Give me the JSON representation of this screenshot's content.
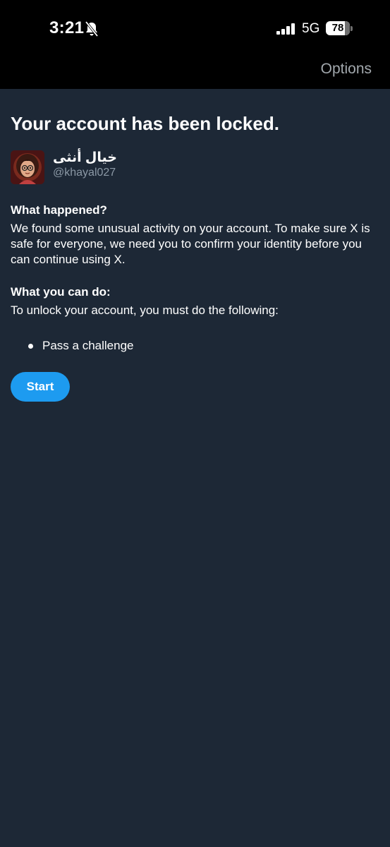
{
  "status_bar": {
    "time": "3:21",
    "network": "5G",
    "battery_percent": "78",
    "battery_level": 0.78,
    "icons": [
      "bell-slash-icon",
      "signal-icon"
    ]
  },
  "nav": {
    "options_label": "Options"
  },
  "main": {
    "title": "Your account has been locked.",
    "profile": {
      "display_name": "خيال أنثى",
      "handle": "@khayal027"
    },
    "what_happened": {
      "heading": "What happened?",
      "text": "We found some unusual activity on your account. To make sure X is safe for everyone, we need you to confirm your identity before you can continue using X."
    },
    "what_you_can_do": {
      "heading": "What you can do:",
      "text": "To unlock your account, you must do the following:",
      "steps": [
        "Pass a challenge"
      ]
    },
    "start_label": "Start"
  },
  "colors": {
    "background": "#1d2836",
    "status_bar": "#000000",
    "accent": "#1d9bf0",
    "secondary_text": "#8b98a5"
  }
}
